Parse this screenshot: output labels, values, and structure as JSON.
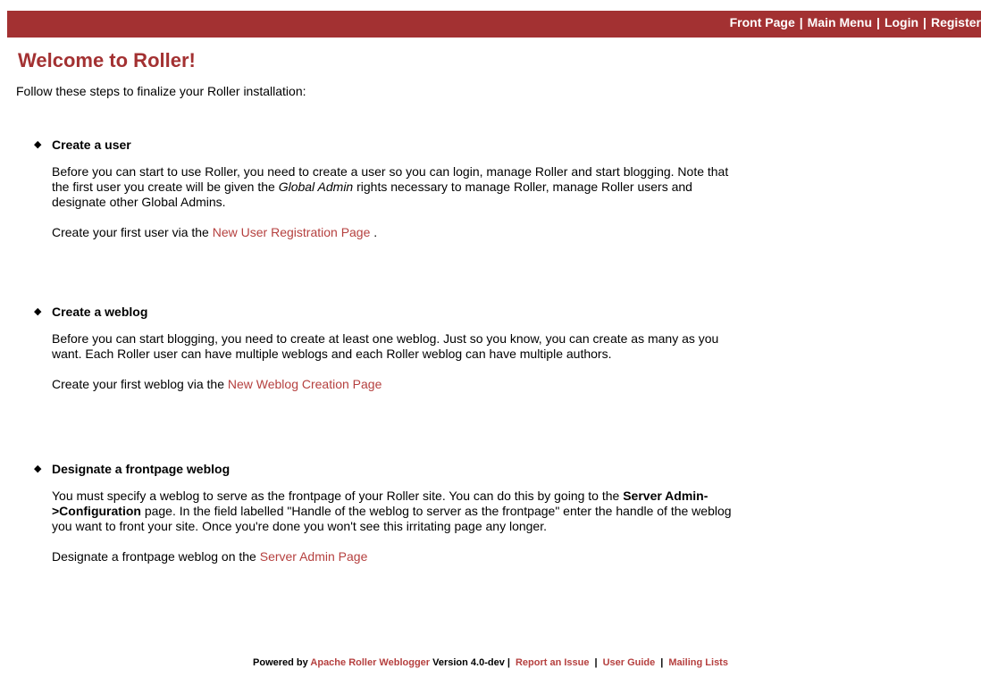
{
  "nav": {
    "front_page": "Front Page",
    "main_menu": "Main Menu",
    "login": "Login",
    "register": "Register",
    "separator": "|"
  },
  "page": {
    "title": "Welcome to Roller!",
    "intro": "Follow these steps to finalize your Roller installation:"
  },
  "steps": [
    {
      "title": "Create a user",
      "para1_a": "Before you can start to use Roller, you need to create a user so you can login, manage Roller and start blogging. Note that the first user you create will be given the ",
      "para1_em": "Global Admin",
      "para1_b": " rights necessary to manage Roller, manage Roller users and designate other Global Admins.",
      "para2_prefix": "Create your first user via the ",
      "link": "New User Registration Page",
      "para2_suffix": " ."
    },
    {
      "title": "Create a weblog",
      "para1": "Before you can start blogging, you need to create at least one weblog. Just so you know, you can create as many as you want. Each Roller user can have multiple weblogs and each Roller weblog can have multiple authors.",
      "para2_prefix": "Create your first weblog via the ",
      "link": "New Weblog Creation Page"
    },
    {
      "title": "Designate a frontpage weblog",
      "para1_a": "You must specify a weblog to serve as the frontpage of your Roller site. You can do this by going to the ",
      "para1_strong": "Server Admin->Configuration",
      "para1_b": " page. In the field labelled \"Handle of the weblog to server as the frontpage\" enter the handle of the weblog you want to front your site. Once you're done you won't see this irritating page any longer.",
      "para2_prefix": "Designate a frontpage weblog on the ",
      "link": "Server Admin Page"
    }
  ],
  "footer": {
    "powered_by": "Powered by ",
    "roller_link": "Apache Roller Weblogger",
    "version": " Version 4.0-dev ",
    "report_issue": "Report an Issue",
    "user_guide": "User Guide",
    "mailing_lists": "Mailing Lists",
    "separator": "|"
  },
  "colors": {
    "header_bar": "#a33132",
    "title": "#a33132",
    "link": "#b5403f"
  }
}
